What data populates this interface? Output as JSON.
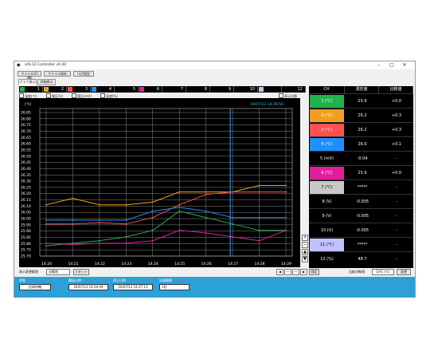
{
  "window": {
    "title": "xOL12 Controller v0.20"
  },
  "menu": [
    "ファイル(F)(略)",
    "ファイル保存",
    "ログ設定"
  ],
  "view_tabs": [
    "グラフ表示",
    "詳細表示"
  ],
  "channels": [
    {
      "num": "1",
      "color": "#22b14c"
    },
    {
      "num": "2",
      "color": "#f0a020"
    },
    {
      "num": "3",
      "color": "#ff5050"
    },
    {
      "num": "4",
      "color": "#1e90ff"
    },
    {
      "num": "5",
      "color": "#000000"
    },
    {
      "num": "6",
      "color": "#e0209a"
    },
    {
      "num": "7",
      "color": "#000000"
    },
    {
      "num": "8",
      "color": "#000000"
    },
    {
      "num": "9",
      "color": "#000000"
    },
    {
      "num": "10",
      "color": "#000000"
    },
    {
      "num": "11",
      "color": "#c0c0ff"
    },
    {
      "num": "12",
      "color": "#000000"
    }
  ],
  "checkboxes": [
    "温度(℃)",
    "電圧(V)",
    "電圧(mV)",
    "湿度(%)",
    "表示切替"
  ],
  "chart": {
    "timestamp": "16/07/13 14:26:59",
    "unit": "(℃)",
    "y_ticks": [
      "26.85",
      "26.80",
      "26.75",
      "26.70",
      "26.65",
      "26.60",
      "26.55",
      "26.50",
      "26.45",
      "26.40",
      "26.35",
      "26.30",
      "26.25",
      "26.20",
      "26.15",
      "26.10",
      "26.05",
      "26.00",
      "25.95",
      "25.90",
      "25.85",
      "25.80",
      "25.75",
      "25.70"
    ],
    "x_ticks": [
      "14:20",
      "14:21",
      "14:22",
      "14:23",
      "14:24",
      "14:25",
      "14:26",
      "14:27",
      "14:28",
      "14:29"
    ]
  },
  "chart_data": {
    "type": "line",
    "ylabel": "(℃)",
    "ylim": [
      25.7,
      26.85
    ],
    "x": [
      "14:20",
      "14:21",
      "14:22",
      "14:23",
      "14:24",
      "14:25",
      "14:26",
      "14:27",
      "14:28",
      "14:29"
    ],
    "grid": true,
    "series": [
      {
        "color": "#22b14c",
        "values": [
          25.78,
          25.8,
          25.82,
          25.85,
          25.9,
          26.05,
          26.0,
          25.95,
          25.9,
          25.9
        ]
      },
      {
        "color": "#f0a020",
        "values": [
          26.1,
          26.15,
          26.1,
          26.1,
          26.12,
          26.2,
          26.2,
          26.2,
          26.25,
          26.25
        ]
      },
      {
        "color": "#ff5050",
        "values": [
          25.95,
          25.95,
          25.96,
          25.95,
          26.0,
          26.1,
          26.18,
          26.2,
          26.2,
          26.2
        ]
      },
      {
        "color": "#1e90ff",
        "values": [
          25.98,
          25.98,
          25.98,
          25.98,
          26.05,
          26.08,
          26.05,
          26.0,
          26.0,
          26.0
        ]
      },
      {
        "color": "#e0209a",
        "values": [
          25.8,
          25.79,
          25.8,
          25.8,
          25.82,
          25.9,
          25.88,
          25.85,
          25.82,
          25.9
        ]
      }
    ]
  },
  "table": {
    "headers": [
      "CH",
      "測定値",
      "比較値"
    ],
    "rows": [
      {
        "ch": "1 (℃)",
        "color": "#22b14c",
        "val": "25.9",
        "cmp": "+0.0"
      },
      {
        "ch": "2 (℃)",
        "color": "#f0a020",
        "val": "26.2",
        "cmp": "+0.3"
      },
      {
        "ch": "3 (℃)",
        "color": "#ff5050",
        "val": "26.2",
        "cmp": "+0.3"
      },
      {
        "ch": "4 (℃)",
        "color": "#1e90ff",
        "val": "26.0",
        "cmp": "+0.1"
      },
      {
        "ch": "5 (mV)",
        "color": "#000000",
        "val": "-0.04",
        "cmp": "-"
      },
      {
        "ch": "6 (℃)",
        "color": "#e0209a",
        "val": "25.9",
        "cmp": "+0.0"
      },
      {
        "ch": "7 (℃)",
        "color": "#c8c8c8",
        "val": "*****",
        "cmp": "-"
      },
      {
        "ch": "8 (V)",
        "color": "#000000",
        "val": "-0.005",
        "cmp": "-"
      },
      {
        "ch": "9 (V)",
        "color": "#000000",
        "val": "-0.005",
        "cmp": "-"
      },
      {
        "ch": "10 (V)",
        "color": "#000000",
        "val": "-0.005",
        "cmp": "-"
      },
      {
        "ch": "11 (℃)",
        "color": "#c0c0ff",
        "val": "*****",
        "cmp": "-"
      },
      {
        "ch": "12 (%)",
        "color": "#000000",
        "val": "48.7",
        "cmp": "-"
      }
    ]
  },
  "controls": {
    "range_label": "表示変更範囲",
    "range_value": "全範囲",
    "reset_label": "リセット",
    "nav": [
      "◀",
      "—",
      "—",
      "▶"
    ],
    "fix_label": "固定",
    "compare_label": "比較対象値",
    "compare_value": "CH1 (℃)",
    "change_label": "変更"
  },
  "bottom": {
    "status_label": "状態",
    "status_value": "記録待機",
    "start_label": "開始日時",
    "start_value": "16/07/13 14:04:09",
    "end_label": "停止日時",
    "end_value": "16/07/13 14:27:13",
    "interval_label": "記録間隔",
    "interval_value": "1秒"
  }
}
